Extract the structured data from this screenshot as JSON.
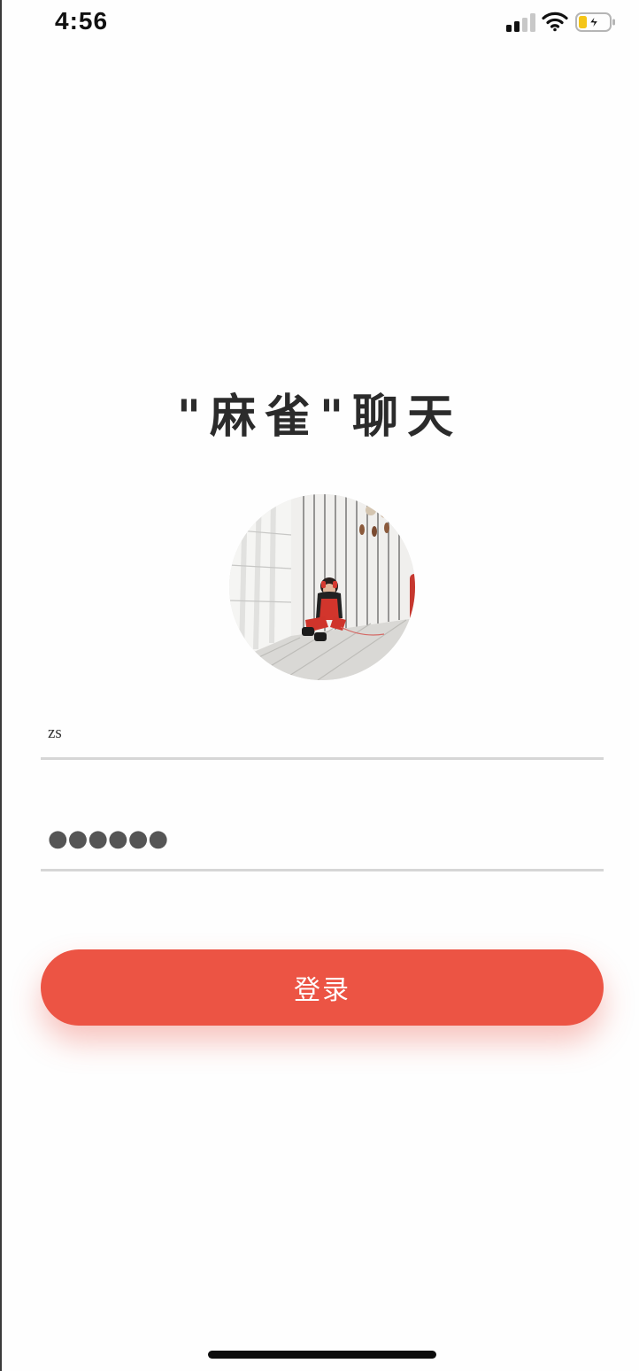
{
  "status_bar": {
    "time": "4:56",
    "signal_icon": "cellular-signal-icon",
    "wifi_icon": "wifi-icon",
    "battery_icon": "battery-charging-icon"
  },
  "login": {
    "title": "\"麻雀\"聊天",
    "avatar_icon": "user-avatar-photo",
    "username_value": "zs",
    "password_value": "●●●●●●",
    "submit_label": "登录"
  },
  "colors": {
    "accent": "#ec5444",
    "title": "#2b2b2b",
    "divider": "#d6d6d6"
  }
}
